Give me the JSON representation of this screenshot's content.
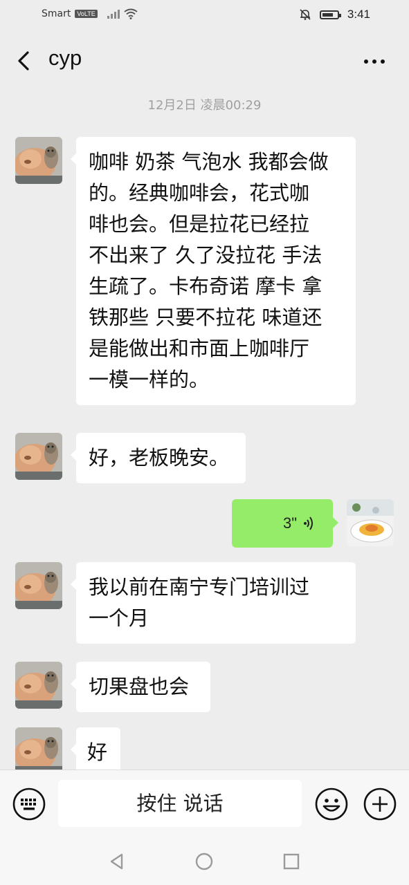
{
  "status_bar": {
    "carrier": "Smart",
    "network_badge": "VoLTE",
    "time": "3:41",
    "icons": [
      "signal-icon",
      "wifi-icon",
      "mute-bell-icon",
      "battery-icon"
    ],
    "battery_level": 0.75
  },
  "header": {
    "title": "cyp",
    "back_icon": "chevron-left-icon",
    "more_icon": "ellipsis-icon"
  },
  "timestamp": "12月2日 凌晨00:29",
  "messages": [
    {
      "from": "other",
      "text": "咖啡 奶茶 气泡水 我都会做\n的。经典咖啡会，花式咖\n啡也会。但是拉花已经拉\n不出来了 久了没拉花 手法\n生疏了。卡布奇诺 摩卡 拿\n铁那些 只要不拉花 味道还\n是能做出和市面上咖啡厅\n一模一样的。"
    },
    {
      "from": "other",
      "text": "好，老板晚安。"
    },
    {
      "from": "me",
      "type": "voice",
      "duration": "3\""
    },
    {
      "from": "other",
      "text": "我以前在南宁专门培训过\n一个月"
    },
    {
      "from": "other",
      "text": "切果盘也会"
    },
    {
      "from": "other",
      "text": "好"
    }
  ],
  "input_bar": {
    "hold_to_talk": "按住 说话",
    "icons": [
      "keyboard-icon",
      "emoji-icon",
      "plus-icon"
    ]
  },
  "nav_bar": {
    "icons": [
      "nav-back-icon",
      "nav-home-icon",
      "nav-recent-icon"
    ]
  },
  "colors": {
    "background": "#ededed",
    "my_bubble": "#95ec69",
    "other_bubble": "#ffffff",
    "timestamp": "#a0a0a0"
  }
}
